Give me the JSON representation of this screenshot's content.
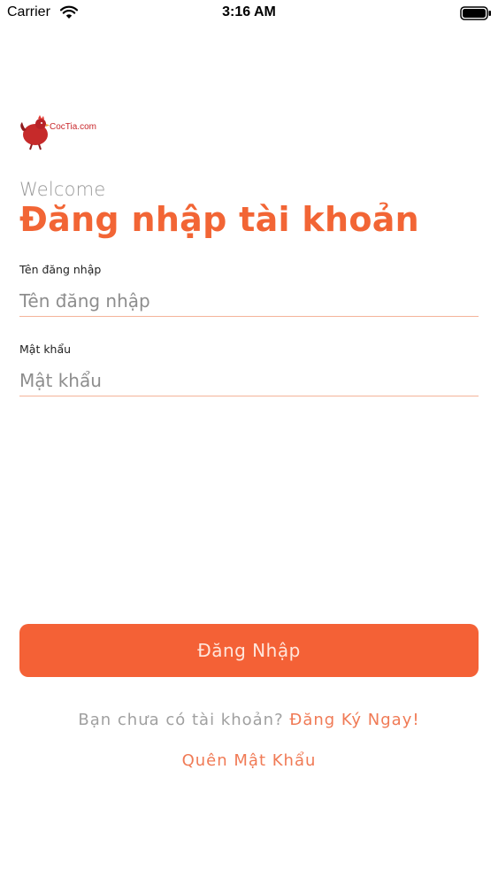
{
  "status_bar": {
    "carrier": "Carrier",
    "time": "3:16 AM"
  },
  "logo": {
    "text": "CocTia.com",
    "icon": "rooster-icon"
  },
  "header": {
    "welcome": "Welcome",
    "title": "Đăng nhập tài khoản"
  },
  "form": {
    "username": {
      "label": "Tên đăng nhập",
      "placeholder": "Tên đăng nhập",
      "value": ""
    },
    "password": {
      "label": "Mật khẩu",
      "placeholder": "Mật khẩu",
      "value": ""
    }
  },
  "actions": {
    "login_label": "Đăng Nhập",
    "signup_prompt": "Bạn chưa có tài khoản?",
    "signup_link": "Đăng Ký Ngay!",
    "forgot_password": "Quên Mật Khẩu"
  },
  "colors": {
    "accent": "#f46136",
    "title": "#f26535",
    "link": "#f07a55",
    "underline": "#f4b49a"
  }
}
